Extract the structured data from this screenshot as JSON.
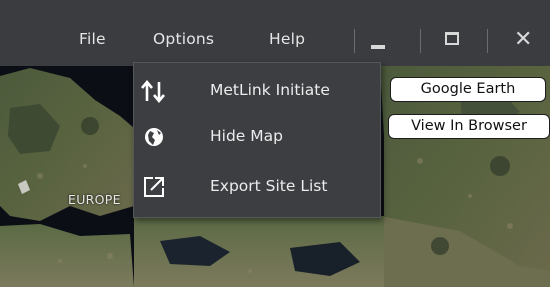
{
  "menubar": {
    "file": "File",
    "options": "Options",
    "help": "Help"
  },
  "window_controls": {
    "minimize_icon": "minimize-icon",
    "maximize_icon": "maximize-icon",
    "close_icon": "close-icon",
    "close_glyph": "✕"
  },
  "dropdown": {
    "items": [
      {
        "label": "MetLink Initiate",
        "icon": "up-down-arrows-icon"
      },
      {
        "label": "Hide Map",
        "icon": "globe-icon"
      },
      {
        "label": "Export Site List",
        "icon": "external-link-icon"
      }
    ]
  },
  "map": {
    "region_label": "EUROPE"
  },
  "side_buttons": {
    "google_earth": "Google Earth",
    "view_in_browser": "View In Browser"
  },
  "colors": {
    "titlebar": "#3a3c40",
    "dropdown_bg": "#3c3e42",
    "text": "#e6e6e6"
  }
}
